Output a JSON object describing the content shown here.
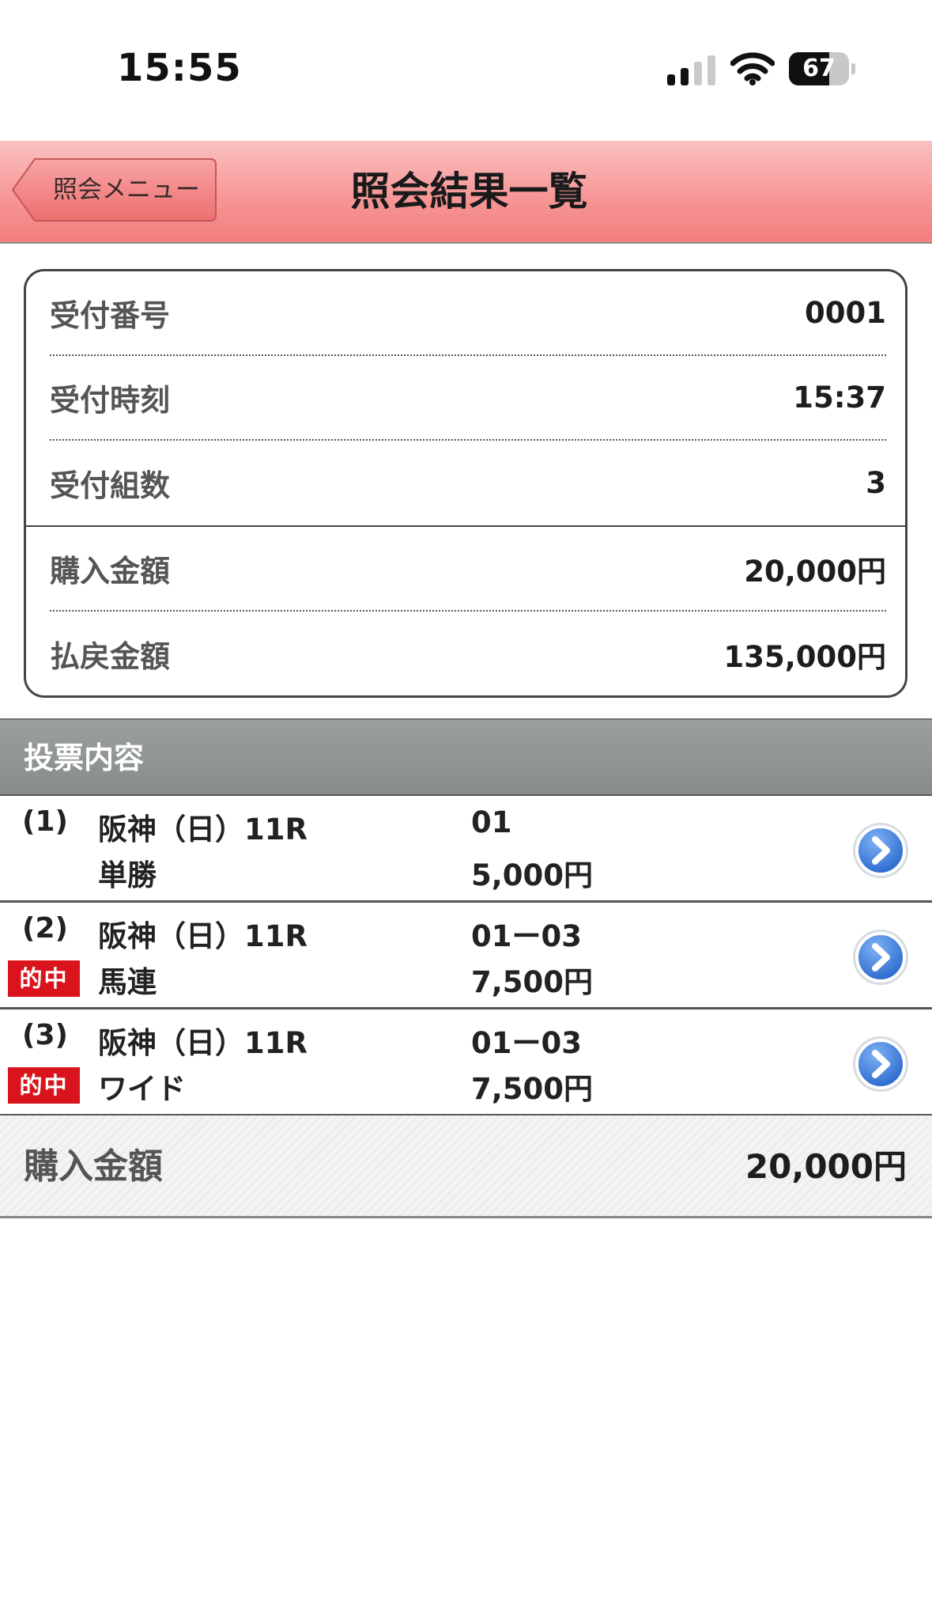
{
  "status_bar": {
    "time": "15:55",
    "battery_level": "67",
    "battery_fraction": 0.67,
    "signal_icon": "cellular-signal-icon",
    "wifi_icon": "wifi-icon"
  },
  "header": {
    "back_label": "照会メニュー",
    "title": "照会結果一覧",
    "color": "#f79797"
  },
  "summary": {
    "rows": [
      {
        "label": "受付番号",
        "value": "0001"
      },
      {
        "label": "受付時刻",
        "value": "15:37"
      },
      {
        "label": "受付組数",
        "value": "3"
      },
      {
        "label": "購入金額",
        "value": "20,000円"
      },
      {
        "label": "払戻金額",
        "value": "135,000円"
      }
    ]
  },
  "section": {
    "title": "投票内容"
  },
  "bets": [
    {
      "num": "(1)",
      "race": "阪神（日）11R",
      "type": "単勝",
      "combo": "01",
      "amount": "5,000円",
      "hit": ""
    },
    {
      "num": "(2)",
      "race": "阪神（日）11R",
      "type": "馬連",
      "combo": "01ー03",
      "amount": "7,500円",
      "hit": "的中"
    },
    {
      "num": "(3)",
      "race": "阪神（日）11R",
      "type": "ワイド",
      "combo": "01ー03",
      "amount": "7,500円",
      "hit": "的中"
    }
  ],
  "total": {
    "label": "購入金額",
    "value": "20,000円"
  },
  "colors": {
    "hit_badge": "#d9141c",
    "detail_icon": "#2e6fd6",
    "section_bg": "#8e9490"
  }
}
